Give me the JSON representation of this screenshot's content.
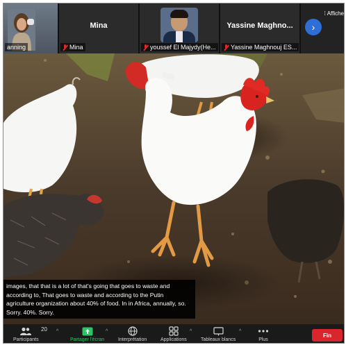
{
  "participants_strip": {
    "tiles": [
      {
        "name": "anning",
        "muted": false
      },
      {
        "big_name": "Mina",
        "name": "Mina",
        "muted": true
      },
      {
        "name": "youssef El Majydy(He...",
        "muted": true
      },
      {
        "big_name": "Yassine  Maghno...",
        "name": "Yassine Maghnouj ES...",
        "muted": true
      }
    ],
    "next_page_icon": "chevron-right-icon",
    "view_label": "Affiche"
  },
  "caption": {
    "text": "images, that that is a lot of that's going that goes to waste and according to, That goes to waste and according to the Putin agriculture organization about 40% of food. In in Africa, annually, so. Sorry. 40%. Sorry."
  },
  "toolbar": {
    "participants_count": "20",
    "items": [
      {
        "label": "Participants",
        "icon": "participants-icon"
      },
      {
        "label": "Partager l'écran",
        "icon": "share-screen-icon",
        "color": "#2ec466"
      },
      {
        "label": "Interprétation",
        "icon": "globe-icon"
      },
      {
        "label": "Applications",
        "icon": "apps-icon"
      },
      {
        "label": "Tableaux blancs",
        "icon": "whiteboard-icon"
      },
      {
        "label": "Plus",
        "icon": "more-icon"
      }
    ],
    "end_label": "Fin",
    "end_color": "#d9262c"
  }
}
